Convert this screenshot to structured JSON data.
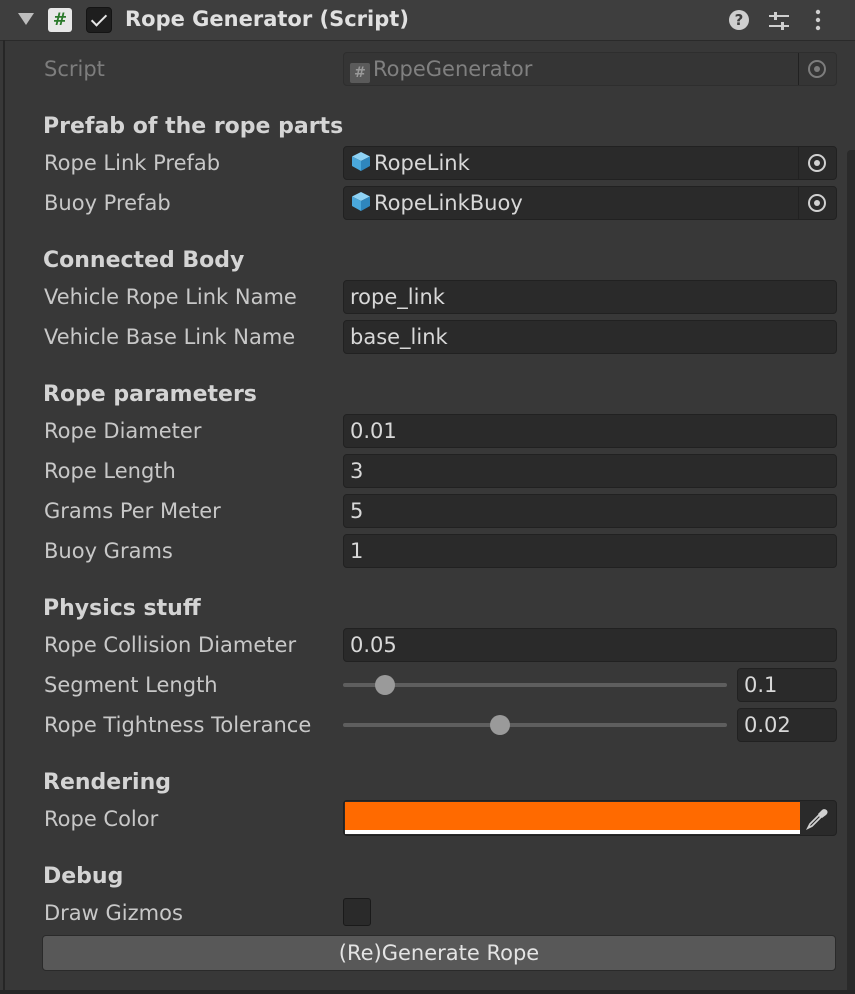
{
  "header": {
    "title": "Rope Generator (Script)",
    "script_icon_glyph": "#",
    "help_glyph": "?",
    "enabled": true
  },
  "script_row": {
    "label": "Script",
    "value": "RopeGenerator"
  },
  "prefab_section": {
    "title": "Prefab of the rope parts",
    "rope_link_label": "Rope Link Prefab",
    "rope_link_value": "RopeLink",
    "buoy_label": "Buoy Prefab",
    "buoy_value": "RopeLinkBuoy"
  },
  "connected_body": {
    "title": "Connected Body",
    "rope_link_name_label": "Vehicle Rope Link Name",
    "rope_link_name_value": "rope_link",
    "base_link_name_label": "Vehicle Base Link Name",
    "base_link_name_value": "base_link"
  },
  "rope_parameters": {
    "title": "Rope parameters",
    "diameter_label": "Rope Diameter",
    "diameter_value": "0.01",
    "length_label": "Rope Length",
    "length_value": "3",
    "grams_per_meter_label": "Grams Per Meter",
    "grams_per_meter_value": "5",
    "buoy_grams_label": "Buoy Grams",
    "buoy_grams_value": "1"
  },
  "physics": {
    "title": "Physics stuff",
    "collision_diameter_label": "Rope Collision Diameter",
    "collision_diameter_value": "0.05",
    "segment_length_label": "Segment Length",
    "segment_length_value": "0.1",
    "segment_length_slider_fraction": 0.11,
    "tightness_label": "Rope Tightness Tolerance",
    "tightness_value": "0.02",
    "tightness_slider_fraction": 0.41
  },
  "rendering": {
    "title": "Rendering",
    "rope_color_label": "Rope Color",
    "rope_color": "#ff6a00"
  },
  "debug": {
    "title": "Debug",
    "draw_gizmos_label": "Draw Gizmos",
    "draw_gizmos": false
  },
  "generate_button_label": "(Re)Generate Rope",
  "icons": {
    "foldout": "foldout-arrow-icon",
    "script": "script-hash-icon",
    "toggle": "checkbox-checked-icon",
    "help": "help-icon",
    "settings": "preset-sliders-icon",
    "menu": "kebab-menu-icon",
    "prefab": "prefab-cube-icon",
    "picker": "object-picker-icon",
    "eyedropper": "eyedropper-icon"
  },
  "colors": {
    "background": "#383838",
    "field": "#2a2a2a",
    "prefab_icon": "#5bb8e8"
  }
}
